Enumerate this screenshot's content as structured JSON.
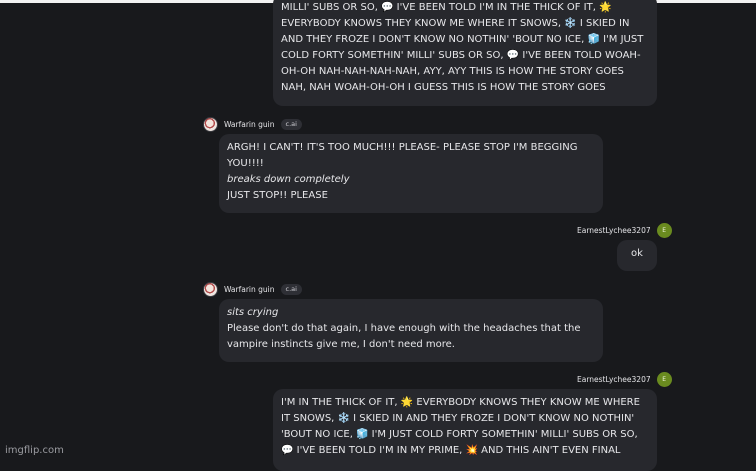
{
  "messages": [
    {
      "lines": [
        "MILLI' SUBS OR SO, 💬 I'VE BEEN TOLD I'M IN THE THICK OF IT, 🌟",
        "EVERYBODY KNOWS THEY KNOW ME WHERE IT SNOWS, ❄️ I SKIED IN",
        "AND THEY FROZE I DON'T KNOW NO NOTHIN' 'BOUT NO ICE, 🧊 I'M JUST",
        "COLD FORTY SOMETHIN' MILLI' SUBS OR SO, 💬 I'VE BEEN TOLD WOAH-",
        "OH-OH NAH-NAH-NAH-NAH, AYY, AYY THIS IS HOW THE STORY GOES",
        "NAH, NAH WOAH-OH-OH I GUESS THIS IS HOW THE STORY GOES"
      ]
    },
    {
      "author": "Warfarin guin",
      "badge": "c.ai",
      "line1": "ARGH! I CAN'T! IT'S TOO MUCH!!! PLEASE- PLEASE STOP I'M BEGGING",
      "line2": "YOU!!!!",
      "action": "breaks down completely",
      "line3": "JUST STOP!! PLEASE"
    },
    {
      "author": "EarnestLychee3207",
      "avatar_letter": "E",
      "text": "ok"
    },
    {
      "author": "Warfarin guin",
      "badge": "c.ai",
      "action": "sits crying",
      "line1": "Please don't do that again, I have enough with the headaches that the",
      "line2": "vampire instincts give me, I don't need more."
    },
    {
      "author": "EarnestLychee3207",
      "avatar_letter": "E",
      "lines": [
        "I'M IN THE THICK OF IT, 🌟 EVERYBODY KNOWS THEY KNOW ME WHERE",
        "IT SNOWS, ❄️ I SKIED IN AND THEY FROZE I DON'T KNOW NO NOTHIN'",
        "'BOUT NO ICE, 🧊 I'M JUST COLD FORTY SOMETHIN' MILLI' SUBS OR SO,",
        "💬 I'VE BEEN TOLD I'M IN MY PRIME, 💥 AND THIS AIN'T EVEN FINAL"
      ]
    }
  ],
  "watermark": "imgflip.com"
}
